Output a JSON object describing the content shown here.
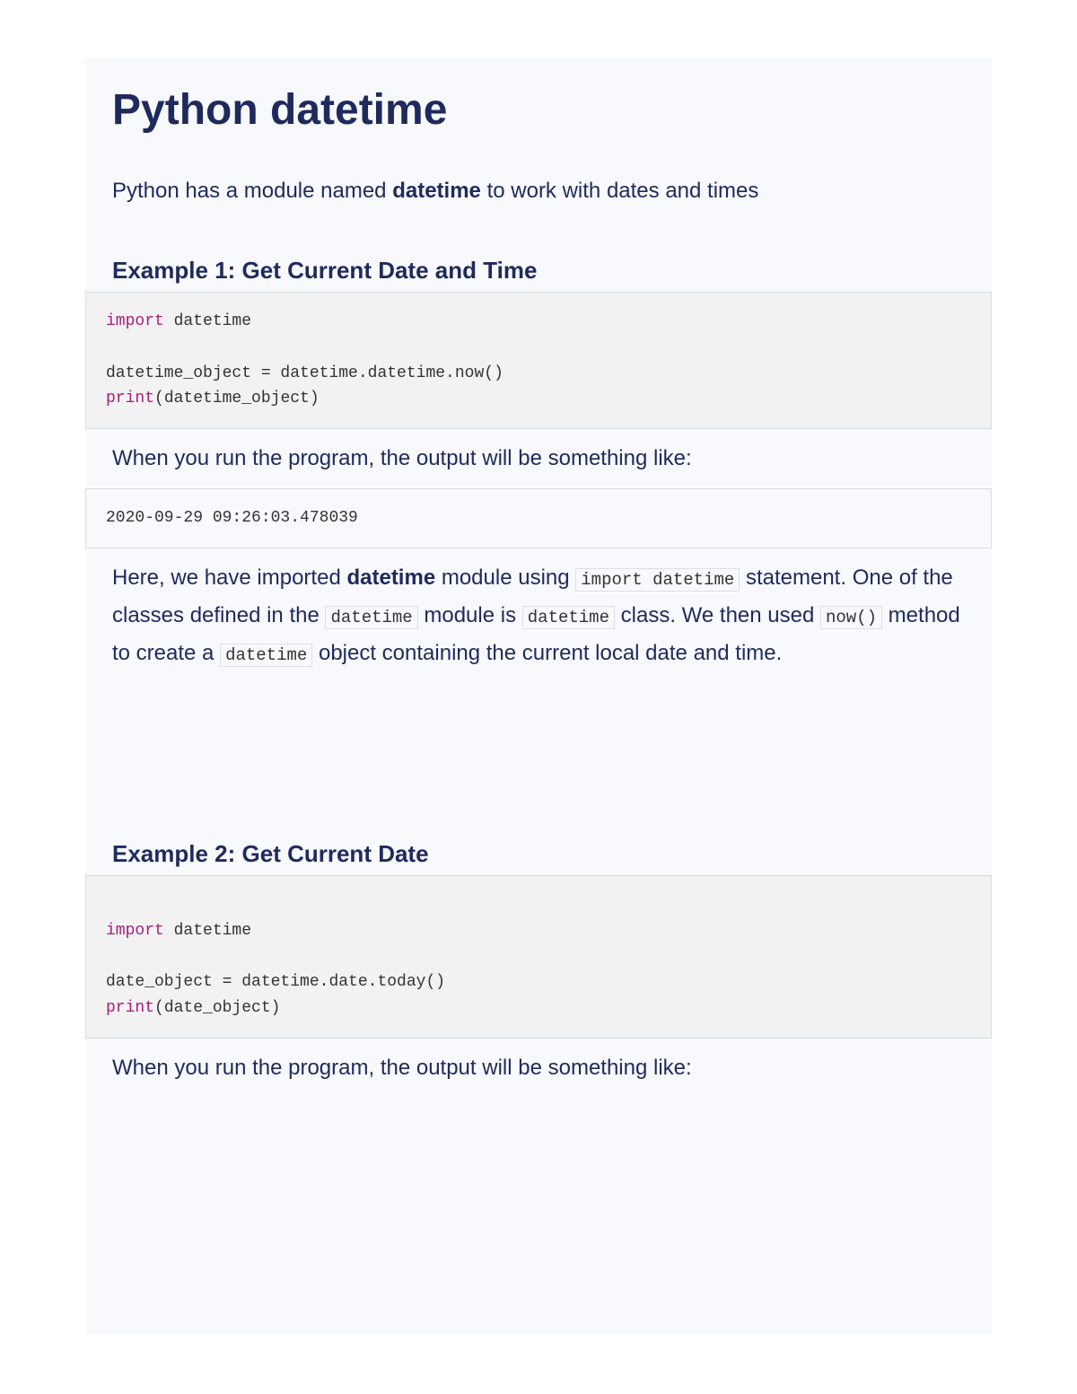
{
  "title": "Python datetime",
  "intro_pre": "Python has a module named ",
  "intro_bold": "datetime",
  "intro_post": " to work with dates and times",
  "example1": {
    "heading": "Example 1: Get Current Date and Time",
    "code": {
      "kw1": "import",
      "line1_rest": " datetime",
      "line2": "datetime_object = datetime.datetime.now()",
      "kw2": "print",
      "line3_rest": "(datetime_object)"
    },
    "output_intro": "When you run the program, the output will be something like:",
    "output": "2020-09-29 09:26:03.478039",
    "explain": {
      "t1": "Here, we have imported ",
      "bold1": "datetime",
      "t2": " module using ",
      "code1": "import datetime",
      "t3": " statement. One of the classes defined in the ",
      "code2": "datetime",
      "t4": " module is ",
      "code3": "datetime",
      "t5": " class. We then used ",
      "code4": "now()",
      "t6": " method to create a ",
      "code5": "datetime",
      "t7": " object containing the current local date and time."
    }
  },
  "example2": {
    "heading": "Example 2: Get Current Date",
    "code": {
      "kw1": "import",
      "line1_rest": " datetime",
      "line2": "date_object = datetime.date.today()",
      "kw2": "print",
      "line3_rest": "(date_object)"
    },
    "output_intro": "When you run the program, the output will be something like:"
  }
}
